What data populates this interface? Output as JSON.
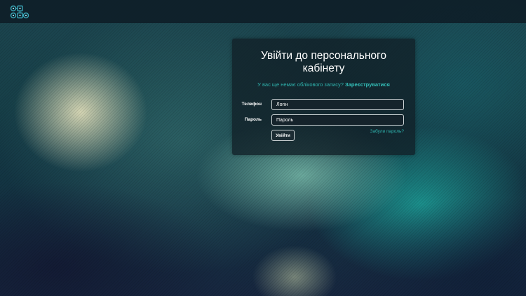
{
  "header": {
    "logo_icon": "network-devices-logo-icon"
  },
  "login_form": {
    "title": "Увійти до персонального кабінету",
    "no_account_text": "У вас ще немає облікового запису?",
    "register_link": "Зареєструватися",
    "phone_label": "Телефон",
    "login_placeholder": "Логін",
    "password_label": "Пароль",
    "password_placeholder": "Пароль",
    "submit_label": "Увійти",
    "forgot_password_link": "Забули пароль?"
  },
  "colors": {
    "accent": "#2fb3ad",
    "card_background": "#122028",
    "topbar_background": "#0e1e28"
  }
}
